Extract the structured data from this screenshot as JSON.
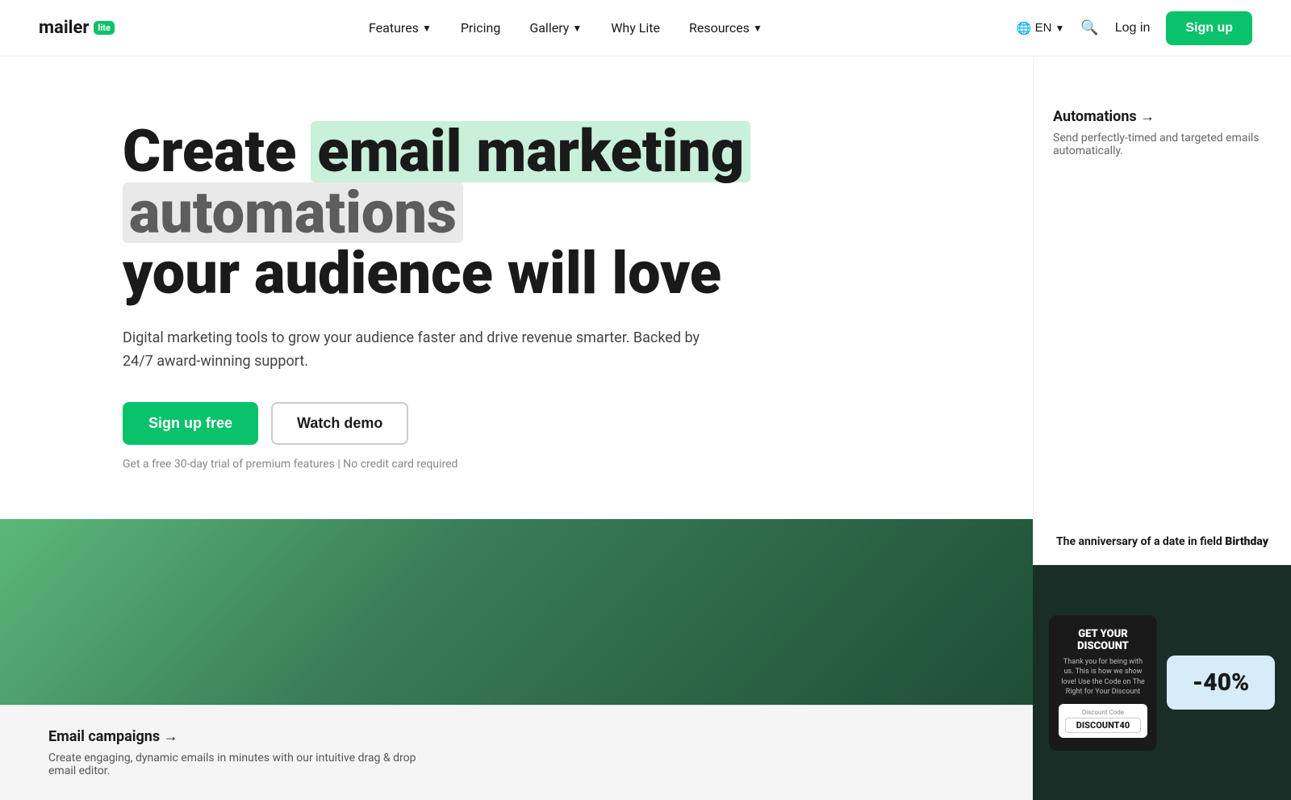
{
  "nav": {
    "logo_text": "mailer",
    "logo_badge": "lite",
    "links": [
      {
        "label": "Features",
        "has_dropdown": true
      },
      {
        "label": "Pricing",
        "has_dropdown": false
      },
      {
        "label": "Gallery",
        "has_dropdown": true
      },
      {
        "label": "Why Lite",
        "has_dropdown": false
      },
      {
        "label": "Resources",
        "has_dropdown": true
      }
    ],
    "lang": "EN",
    "login_label": "Log in",
    "signup_label": "Sign up"
  },
  "hero": {
    "headline_start": "Create",
    "highlight1": "email marketing",
    "highlight2": "automations",
    "headline_end": "your audience will love",
    "subtext": "Digital marketing tools to grow your audience faster and drive revenue smarter. Backed by 24/7 award-winning support.",
    "cta_primary": "Sign up free",
    "cta_secondary": "Watch demo",
    "note": "Get a free 30-day trial of premium features | No credit card required"
  },
  "right_panel": {
    "automations_title": "Automations →",
    "automations_desc": "Send perfectly-timed and targeted emails automatically.",
    "anniversary_text": "The anniversary of a date in field",
    "anniversary_field": "Birthday",
    "discount_card1_title": "GET YOUR DISCOUNT",
    "discount_card1_body": "Thank you for being with us. This is how we show love! Use the Code on The Right for Your Discount",
    "discount_card1_label": "Right for Your Discount",
    "discount_code": "DISCOUNT40",
    "discount_pct": "-40%"
  },
  "bottom": {
    "email_campaigns_title": "Email campaigns →",
    "email_campaigns_desc": "Create engaging, dynamic emails in minutes with our intuitive drag & drop email editor."
  }
}
